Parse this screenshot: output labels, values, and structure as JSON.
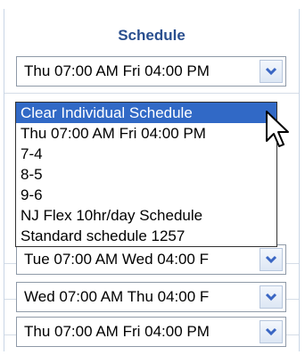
{
  "header": {
    "title": "Schedule"
  },
  "selects": [
    {
      "value": "Thu 07:00 AM Fri 04:00 PM"
    },
    {
      "value": "Tue 07:00 AM Wed 04:00 F"
    },
    {
      "value": "Wed 07:00 AM Thu 04:00 F"
    },
    {
      "value": "Thu 07:00 AM Fri 04:00 PM"
    }
  ],
  "dropdown": {
    "options": [
      "Clear Individual Schedule",
      "Thu 07:00 AM Fri 04:00 PM",
      "7-4",
      "8-5",
      "9-6",
      "NJ Flex 10hr/day Schedule",
      "Standard schedule 1257"
    ],
    "highlighted_option": "Clear Individual Schedule"
  },
  "icons": {
    "select_arrow": "chevron-down-icon",
    "cursor": "mouse-pointer-icon"
  },
  "colors": {
    "header_text": "#2a4f8f",
    "highlight": "#3169c6",
    "arrow": "#3a66c3"
  }
}
